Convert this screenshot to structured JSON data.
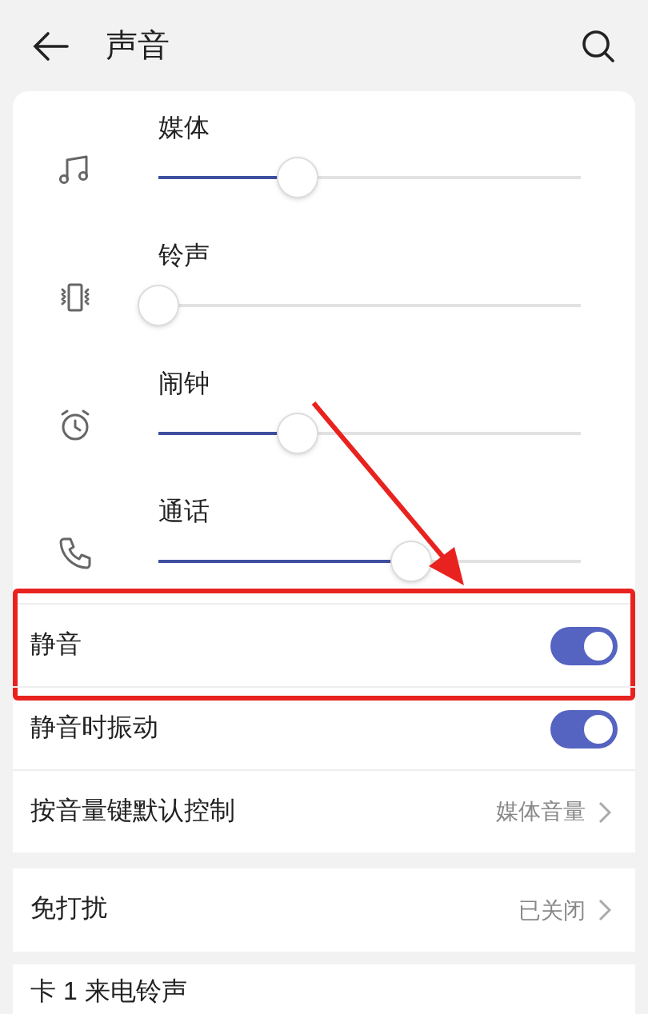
{
  "header": {
    "title": "声音"
  },
  "volumes": [
    {
      "label": "媒体",
      "level": 0.33
    },
    {
      "label": "铃声",
      "level": 0
    },
    {
      "label": "闹钟",
      "level": 0.33
    },
    {
      "label": "通话",
      "level": 0.6
    }
  ],
  "settings": [
    {
      "label": "静音",
      "kind": "toggle",
      "on": true,
      "highlighted": true
    },
    {
      "label": "静音时振动",
      "kind": "toggle",
      "on": true,
      "highlighted": false
    },
    {
      "label": "按音量键默认控制",
      "kind": "link",
      "value": "媒体音量"
    }
  ],
  "dnd": {
    "label": "免打扰",
    "value": "已关闭"
  },
  "ringtone": {
    "label": "卡 1 来电铃声"
  }
}
